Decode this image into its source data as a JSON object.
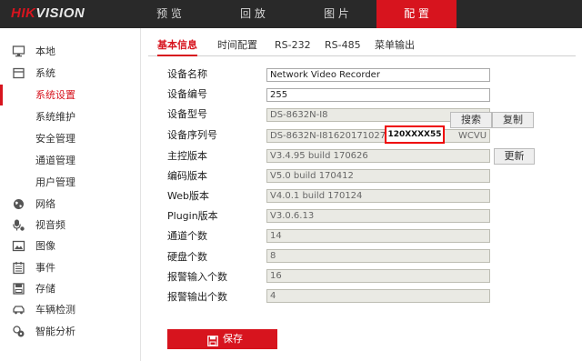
{
  "brand": {
    "logo_red": "HIK",
    "logo_rest": "VISION"
  },
  "topnav": {
    "items": [
      {
        "label": "预 览"
      },
      {
        "label": "回 放"
      },
      {
        "label": "图 片"
      },
      {
        "label": "配 置",
        "active": true
      }
    ]
  },
  "sidebar": {
    "items": [
      {
        "label": "本地",
        "icon": "monitor-icon"
      },
      {
        "label": "系统",
        "icon": "system-icon"
      },
      {
        "label": "系统设置",
        "active": true
      },
      {
        "label": "系统维护"
      },
      {
        "label": "安全管理"
      },
      {
        "label": "通道管理"
      },
      {
        "label": "用户管理"
      },
      {
        "label": "网络",
        "icon": "globe-icon"
      },
      {
        "label": "视音频",
        "icon": "audio-video-icon"
      },
      {
        "label": "图像",
        "icon": "image-icon"
      },
      {
        "label": "事件",
        "icon": "event-icon"
      },
      {
        "label": "存储",
        "icon": "storage-icon"
      },
      {
        "label": "车辆检测",
        "icon": "vehicle-icon"
      },
      {
        "label": "智能分析",
        "icon": "smart-analysis-icon"
      }
    ]
  },
  "tabs": [
    {
      "label": "基本信息",
      "active": true
    },
    {
      "label": "时间配置"
    },
    {
      "label": "RS-232"
    },
    {
      "label": "RS-485"
    },
    {
      "label": "菜单输出"
    }
  ],
  "form": {
    "rows": [
      {
        "label": "设备名称",
        "value": "Network Video Recorder",
        "editable": true
      },
      {
        "label": "设备编号",
        "value": "255",
        "editable": true
      },
      {
        "label": "设备型号",
        "value": "DS-8632N-I8",
        "editable": false
      },
      {
        "label": "设备序列号",
        "value": "DS-8632N-I81620171027CC",
        "value_tail": "WCVU",
        "editable": false
      },
      {
        "label": "主控版本",
        "value": "V3.4.95 build 170626",
        "editable": false
      },
      {
        "label": "编码版本",
        "value": "V5.0 build 170412",
        "editable": false
      },
      {
        "label": "Web版本",
        "value": "V4.0.1 build 170124",
        "editable": false
      },
      {
        "label": "Plugin版本",
        "value": "V3.0.6.13",
        "editable": false
      },
      {
        "label": "通道个数",
        "value": "14",
        "editable": false
      },
      {
        "label": "硬盘个数",
        "value": "8",
        "editable": false
      },
      {
        "label": "报警输入个数",
        "value": "16",
        "editable": false
      },
      {
        "label": "报警输出个数",
        "value": "4",
        "editable": false
      }
    ],
    "search_label": "搜索",
    "copy_label": "复制",
    "update_label": "更新",
    "serial_callout": "120XXXX55",
    "save_label": "保存"
  },
  "colors": {
    "accent": "#d7141e",
    "topbar": "#292929",
    "readonly_bg": "#eaeae4"
  }
}
